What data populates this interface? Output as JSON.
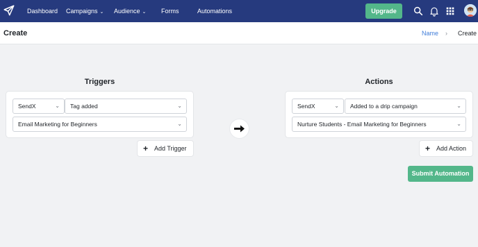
{
  "nav": {
    "logo_icon": "paper-plane-icon",
    "items": [
      {
        "label": "Dashboard",
        "has_dropdown": false
      },
      {
        "label": "Campaigns",
        "has_dropdown": true
      },
      {
        "label": "Audience",
        "has_dropdown": true
      },
      {
        "label": "Forms",
        "has_dropdown": false
      },
      {
        "label": "Automations",
        "has_dropdown": false
      }
    ],
    "upgrade_label": "Upgrade",
    "icons": [
      "search-icon",
      "bell-icon",
      "apps-grid-icon"
    ],
    "colors": {
      "bar": "#263a7e",
      "upgrade": "#53b78a"
    }
  },
  "header": {
    "title": "Create",
    "breadcrumb": {
      "link": "Name",
      "separator": "›",
      "current": "Create"
    }
  },
  "triggers": {
    "title": "Triggers",
    "app_select": "SendX",
    "event_select": "Tag added",
    "value_select": "Email Marketing for Beginners",
    "add_label": "Add Trigger"
  },
  "actions": {
    "title": "Actions",
    "app_select": "SendX",
    "event_select": "Added to a drip campaign",
    "value_select": "Nurture Students - Email Marketing for Beginners",
    "add_label": "Add Action"
  },
  "arrow_icon": "arrow-right-icon",
  "submit_label": "Submit Automation"
}
